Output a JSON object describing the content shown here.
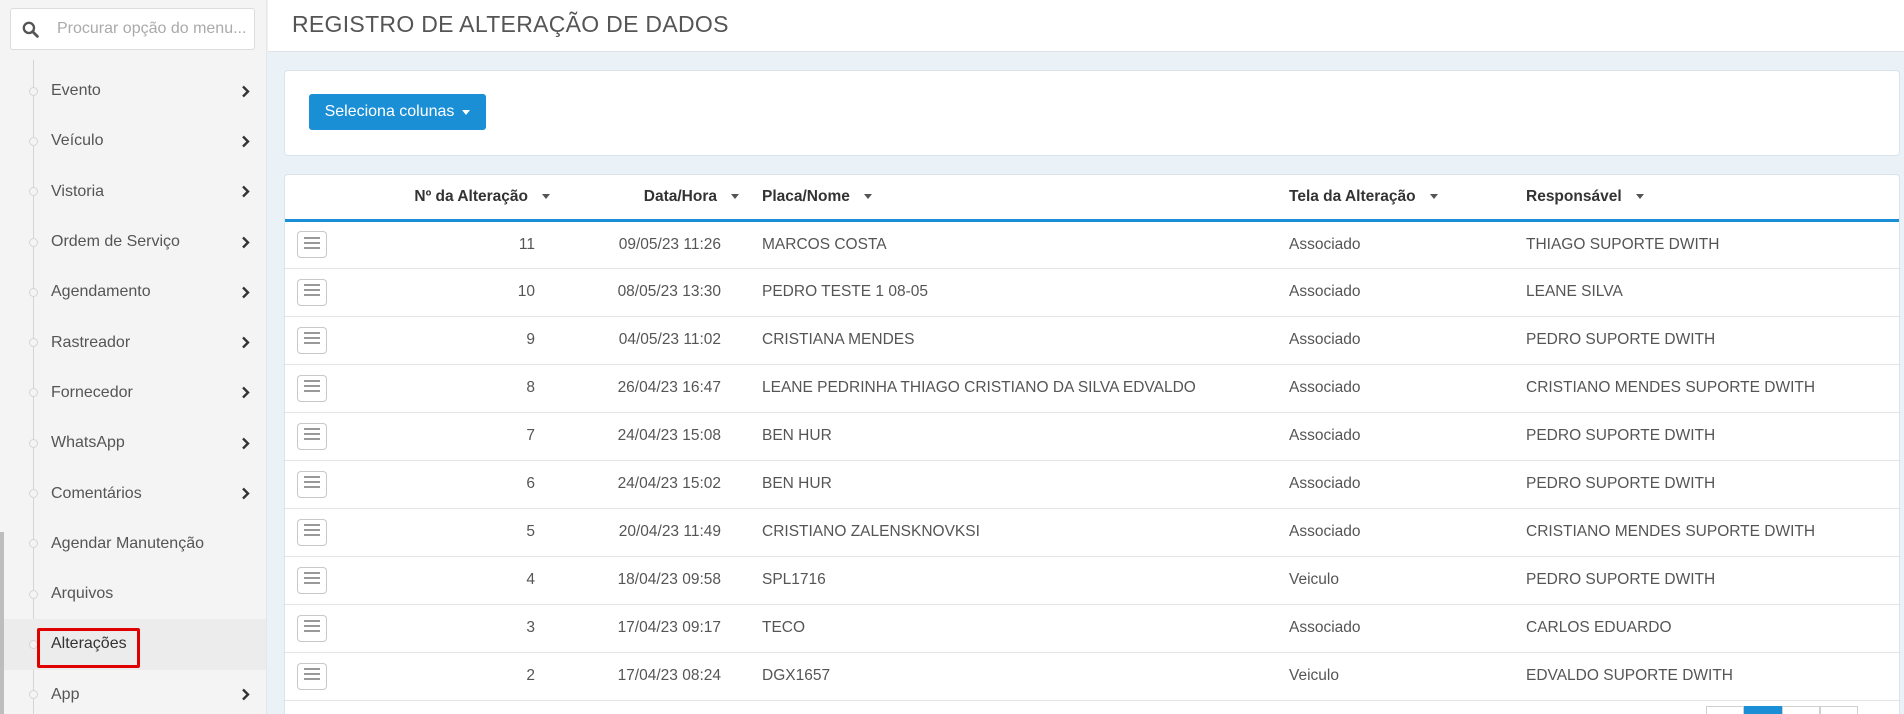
{
  "sidebar": {
    "search_placeholder": "Procurar opção do menu...",
    "items": [
      {
        "label": "Evento",
        "has_arrow": true
      },
      {
        "label": "Veículo",
        "has_arrow": true
      },
      {
        "label": "Vistoria",
        "has_arrow": true
      },
      {
        "label": "Ordem de Serviço",
        "has_arrow": true
      },
      {
        "label": "Agendamento",
        "has_arrow": true
      },
      {
        "label": "Rastreador",
        "has_arrow": true
      },
      {
        "label": "Fornecedor",
        "has_arrow": true
      },
      {
        "label": "WhatsApp",
        "has_arrow": true
      },
      {
        "label": "Comentários",
        "has_arrow": true
      },
      {
        "label": "Agendar Manutenção",
        "has_arrow": false
      },
      {
        "label": "Arquivos",
        "has_arrow": false
      },
      {
        "label": "Alterações",
        "has_arrow": false,
        "active": true
      },
      {
        "label": "App",
        "has_arrow": true
      }
    ]
  },
  "header": {
    "title": "REGISTRO DE ALTERAÇÃO DE DADOS"
  },
  "toolbar": {
    "columns_button": "Seleciona colunas"
  },
  "table": {
    "columns": {
      "num": "Nº da Alteração",
      "date": "Data/Hora",
      "placa": "Placa/Nome",
      "tela": "Tela da Alteração",
      "resp": "Responsável"
    },
    "rows": [
      {
        "num": "11",
        "date": "09/05/23 11:26",
        "placa": "MARCOS COSTA",
        "tela": "Associado",
        "resp": "THIAGO SUPORTE DWITH"
      },
      {
        "num": "10",
        "date": "08/05/23 13:30",
        "placa": "PEDRO TESTE 1 08-05",
        "tela": "Associado",
        "resp": "LEANE SILVA"
      },
      {
        "num": "9",
        "date": "04/05/23 11:02",
        "placa": "CRISTIANA MENDES",
        "tela": "Associado",
        "resp": "PEDRO SUPORTE DWITH"
      },
      {
        "num": "8",
        "date": "26/04/23 16:47",
        "placa": "LEANE PEDRINHA THIAGO CRISTIANO DA SILVA EDVALDO",
        "tela": "Associado",
        "resp": "CRISTIANO MENDES SUPORTE DWITH"
      },
      {
        "num": "7",
        "date": "24/04/23 15:08",
        "placa": "BEN HUR",
        "tela": "Associado",
        "resp": "PEDRO SUPORTE DWITH"
      },
      {
        "num": "6",
        "date": "24/04/23 15:02",
        "placa": "BEN HUR",
        "tela": "Associado",
        "resp": "PEDRO SUPORTE DWITH"
      },
      {
        "num": "5",
        "date": "20/04/23 11:49",
        "placa": "CRISTIANO ZALENSKNOVKSI",
        "tela": "Associado",
        "resp": "CRISTIANO MENDES SUPORTE DWITH"
      },
      {
        "num": "4",
        "date": "18/04/23 09:58",
        "placa": "SPL1716",
        "tela": "Veiculo",
        "resp": "PEDRO SUPORTE DWITH"
      },
      {
        "num": "3",
        "date": "17/04/23 09:17",
        "placa": "TECO",
        "tela": "Associado",
        "resp": "CARLOS EDUARDO"
      },
      {
        "num": "2",
        "date": "17/04/23 08:24",
        "placa": "DGX1657",
        "tela": "Veiculo",
        "resp": "EDVALDO SUPORTE DWITH"
      }
    ]
  },
  "colors": {
    "accent": "#1a8fd6",
    "highlight": "#e00000"
  }
}
